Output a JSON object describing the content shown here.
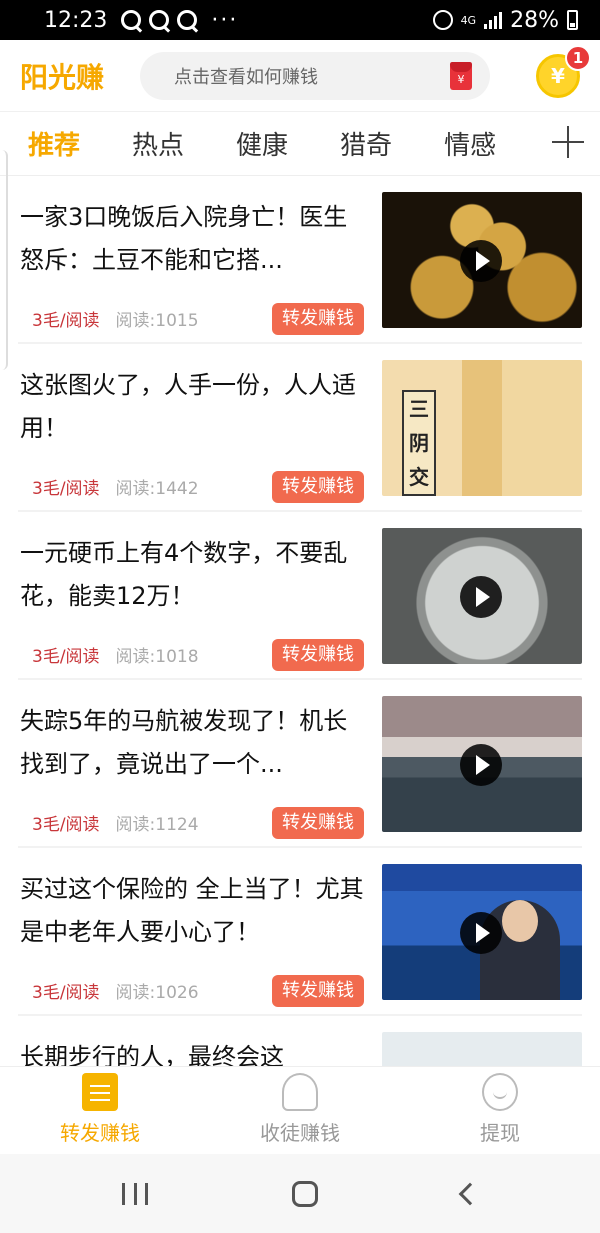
{
  "status_bar": {
    "time": "12:23",
    "notification_icons": [
      "qq-icon",
      "qq-icon",
      "qq-icon"
    ],
    "overflow": "···",
    "network": "4G",
    "battery": "28%"
  },
  "header": {
    "logo": "阳光赚",
    "search_placeholder": "点击查看如何赚钱",
    "coin_symbol": "¥",
    "badge_count": "1"
  },
  "tabs": [
    {
      "label": "推荐",
      "active": true
    },
    {
      "label": "热点"
    },
    {
      "label": "健康"
    },
    {
      "label": "猎奇"
    },
    {
      "label": "情感"
    }
  ],
  "feed": [
    {
      "title": "一家3口晚饭后入院身亡！医生怒斥：土豆不能和它搭...",
      "rate": "3毛/阅读",
      "reads": "阅读:1015",
      "action": "转发赚钱",
      "video": true
    },
    {
      "title": "这张图火了，人手一份，人人适用！",
      "rate": "3毛/阅读",
      "reads": "阅读:1442",
      "action": "转发赚钱",
      "video": false,
      "thumb_text": "三阴交"
    },
    {
      "title": "一元硬币上有4个数字，不要乱花，能卖12万！",
      "rate": "3毛/阅读",
      "reads": "阅读:1018",
      "action": "转发赚钱",
      "video": true
    },
    {
      "title": "失踪5年的马航被发现了！机长找到了，竟说出了一个...",
      "rate": "3毛/阅读",
      "reads": "阅读:1124",
      "action": "转发赚钱",
      "video": true
    },
    {
      "title": "买过这个保险的 全上当了！尤其是中老年人要小心了！",
      "rate": "3毛/阅读",
      "reads": "阅读:1026",
      "action": "转发赚钱",
      "video": true
    },
    {
      "title": "长期步行的人，最终会这",
      "rate": "",
      "reads": "",
      "action": "",
      "video": false
    }
  ],
  "bottom_tabs": [
    {
      "label": "转发赚钱",
      "icon": "share-doc-icon",
      "active": true
    },
    {
      "label": "收徒赚钱",
      "icon": "users-icon"
    },
    {
      "label": "提现",
      "icon": "smile-icon"
    }
  ],
  "colors": {
    "brand": "#f6a800",
    "share_button": "#f16a4e",
    "rate_text": "#c8363a",
    "badge": "#e83a3a"
  }
}
